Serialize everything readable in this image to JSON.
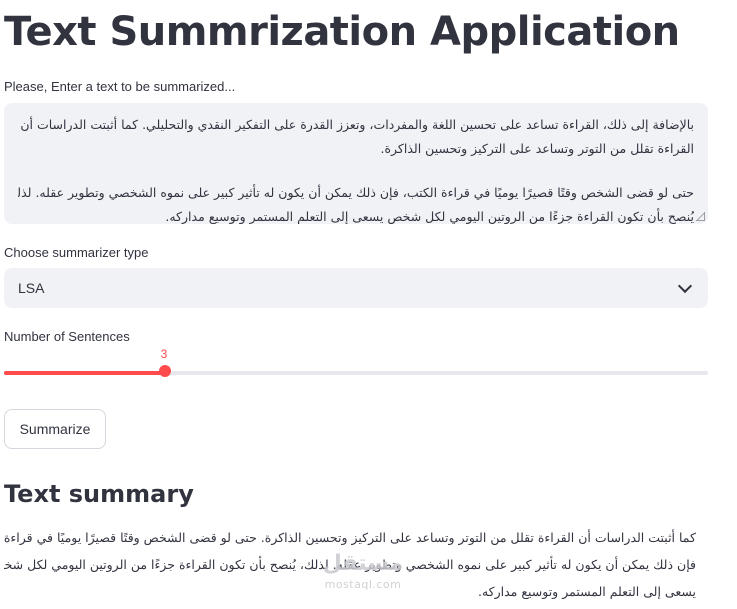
{
  "app": {
    "title": "Text Summrization Application"
  },
  "input": {
    "label": "Please, Enter a text to be summarized...",
    "lines": [
      "بالإضافة إلى ذلك، القراءة تساعد على تحسين اللغة والمفردات، وتعزز القدرة على التفكير النقدي والتحليلي. كما أثبتت الدراسات أن",
      "القراءة تقلل من التوتر وتساعد على التركيز وتحسين الذاكرة.",
      "حتى لو قضى الشخص وقتًا قصيرًا يوميًا في قراءة الكتب، فإن ذلك يمكن أن يكون له تأثير كبير على نموه الشخصي وتطوير عقله. لذلك،",
      "يُنصح بأن تكون القراءة جزءًا من الروتين اليومي لكل شخص يسعى إلى التعلم المستمر وتوسيع مداركه."
    ]
  },
  "summarizer": {
    "label": "Choose summarizer type",
    "selected": "LSA"
  },
  "sentences": {
    "label": "Number of Sentences",
    "value": "3",
    "fraction": 0.228
  },
  "button": {
    "label": "Summarize"
  },
  "summary": {
    "heading": "Text summary",
    "lines": [
      "كما أثبتت الدراسات أن القراءة تقلل من التوتر وتساعد على التركيز وتحسين الذاكرة. حتى لو قضى الشخص وقتًا قصيرًا يوميًا في قراءة الكتب،",
      "فإن ذلك يمكن أن يكون له تأثير كبير على نموه الشخصي وتطوير عقله. لذلك، يُنصح بأن تكون القراءة جزءًا من الروتين اليومي لكل شخص",
      "يسعى إلى التعلم المستمر وتوسيع مداركه."
    ]
  },
  "watermark": {
    "arabic": "مستقل",
    "latin": "mostaql.com"
  },
  "colors": {
    "accent": "#ff4b4b",
    "input_bg": "#f0f2f6",
    "text": "#31333f"
  }
}
